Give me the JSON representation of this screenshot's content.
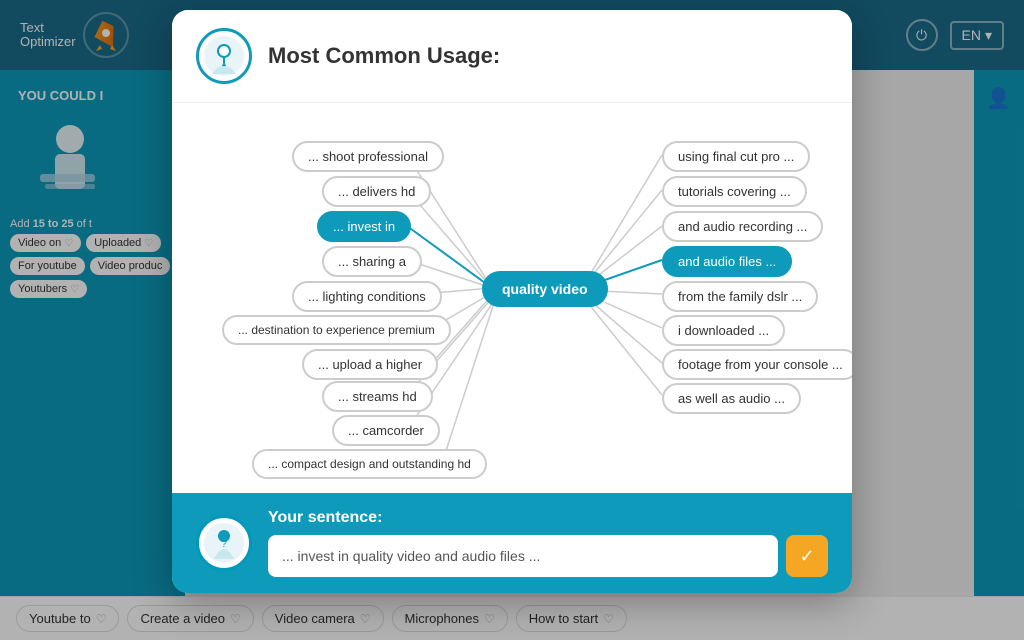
{
  "header": {
    "logo_line1": "Text",
    "logo_line2": "Optimizer",
    "lang": "EN",
    "power_icon": "⏻",
    "chevron_icon": "▾"
  },
  "modal": {
    "title": "Most Common Usage:",
    "center_node": "quality video",
    "nodes_left": [
      {
        "id": "shoot",
        "label": "... shoot professional",
        "active": false
      },
      {
        "id": "delivers",
        "label": "... delivers hd",
        "active": false
      },
      {
        "id": "invest",
        "label": "... invest in",
        "active": true
      },
      {
        "id": "sharing",
        "label": "... sharing a",
        "active": false
      },
      {
        "id": "lighting",
        "label": "... lighting conditions",
        "active": false
      },
      {
        "id": "destination",
        "label": "... destination to experience premium",
        "active": false
      },
      {
        "id": "upload",
        "label": "... upload a higher",
        "active": false
      },
      {
        "id": "streams",
        "label": "... streams hd",
        "active": false
      },
      {
        "id": "camcorder",
        "label": "... camcorder",
        "active": false
      },
      {
        "id": "compact",
        "label": "... compact design and outstanding hd",
        "active": false
      }
    ],
    "nodes_right": [
      {
        "id": "finalcut",
        "label": "using final cut pro ...",
        "active": false
      },
      {
        "id": "tutorials",
        "label": "tutorials covering ...",
        "active": false
      },
      {
        "id": "audio_recording",
        "label": "and audio recording ...",
        "active": false
      },
      {
        "id": "audio_files",
        "label": "and audio files ...",
        "active": true
      },
      {
        "id": "family_dslr",
        "label": "from the family dslr ...",
        "active": false
      },
      {
        "id": "downloaded",
        "label": "i downloaded ...",
        "active": false
      },
      {
        "id": "footage",
        "label": "footage from your console ...",
        "active": false
      },
      {
        "id": "as_well",
        "label": "as well as audio ...",
        "active": false
      }
    ],
    "sentence_label": "Your sentence:",
    "sentence_value": "... invest in quality video and audio files ...",
    "submit_icon": "✓"
  },
  "sidebar": {
    "you_could": "YOU COULD I",
    "add_text": "Add",
    "bold_range": "15 to 25",
    "add_text2": "of t",
    "tags": [
      {
        "label": "Video on"
      },
      {
        "label": "Uploaded"
      },
      {
        "label": "For youtube"
      },
      {
        "label": "Video produc"
      },
      {
        "label": "Youtubers"
      }
    ]
  },
  "bottom_tags": [
    {
      "label": "Youtube to"
    },
    {
      "label": "Create a video"
    },
    {
      "label": "Video camera"
    },
    {
      "label": "Microphones"
    },
    {
      "label": "How to start"
    }
  ]
}
